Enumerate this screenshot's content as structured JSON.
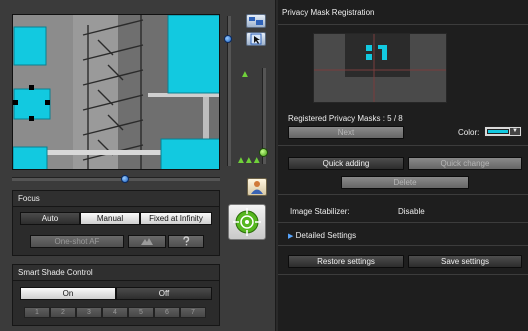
{
  "colors": {
    "mask": "#12c9e0",
    "accent_blue": "#1a5fbf",
    "accent_green": "#56b71f"
  },
  "focus": {
    "title": "Focus",
    "modes": [
      "Auto",
      "Manual",
      "Fixed at Infinity"
    ],
    "selected_mode": "Auto",
    "one_shot_af": "One-shot AF",
    "icons": [
      "mountain-icon",
      "question-icon"
    ]
  },
  "smart_shade": {
    "title": "Smart Shade Control",
    "on_label": "On",
    "off_label": "Off",
    "selected": "On",
    "levels": [
      "1",
      "2",
      "3",
      "4",
      "5",
      "6",
      "7"
    ]
  },
  "privacy_mask": {
    "title": "Privacy Mask Registration",
    "registered_label": "Registered Privacy Masks : 5 / 8",
    "next_button": "Next",
    "color_label": "Color:",
    "color_value": "#12c9e0",
    "quick_adding": "Quick adding",
    "quick_change": "Quick change",
    "delete": "Delete"
  },
  "stabilizer": {
    "label": "Image Stabilizer:",
    "value": "Disable"
  },
  "detailed_settings": "Detailed Settings",
  "footer": {
    "restore": "Restore settings",
    "save": "Save settings"
  }
}
